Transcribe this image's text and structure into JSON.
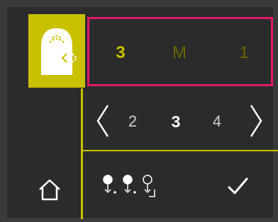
{
  "colors": {
    "accent": "#c9c000",
    "highlight_border": "#e0186b",
    "background": "#2b2b2b",
    "dim_text": "#6a6700"
  },
  "mode_tile": {
    "icon": "clean-room-unit-icon"
  },
  "mode_row": {
    "items": [
      {
        "label": "3",
        "active": true
      },
      {
        "label": "M",
        "active": false
      },
      {
        "label": "1",
        "active": false
      }
    ]
  },
  "selector": {
    "prev_icon": "chevron-left-icon",
    "next_icon": "chevron-right-icon",
    "options": [
      {
        "label": "2",
        "active": false
      },
      {
        "label": "3",
        "active": true
      },
      {
        "label": "4",
        "active": false
      }
    ]
  },
  "bottom": {
    "home_icon": "home-icon",
    "pins_icon": "pins-sequence-icon",
    "confirm_icon": "checkmark-icon"
  }
}
